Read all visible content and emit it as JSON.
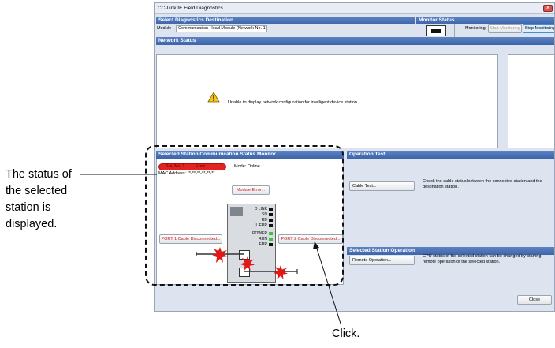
{
  "window": {
    "title": "CC-Link IE Field Diagnostics",
    "close_glyph": "✕"
  },
  "destination": {
    "header": "Select Diagnostics Destination",
    "module_label": "Module",
    "module_value": "Communication Head Module (Network No. 1)"
  },
  "monitor": {
    "header": "Monitor Status",
    "status_text": "Monitoring",
    "start_label": "Start Monitoring",
    "stop_label": "Stop Monitoring"
  },
  "network": {
    "header": "Network Status",
    "warning_icon": "warning-icon",
    "message": "Unable to display network configuration for intelligent device station."
  },
  "station_monitor": {
    "header": "Selected Station Communication Status Monitor",
    "station_no": "Sta. No. 1",
    "station_state": "Error",
    "mode": "Mode:  Online",
    "mac": "MAC Address: **-**-**-**-**-**",
    "module_error_label": "Module Error...",
    "port1_label": "PORT 1 Cable Disconnected...",
    "port2_label": "PORT 2 Cable Disconnected...",
    "leds_top": [
      "D LINK",
      "SD",
      "RD",
      "L ERR"
    ],
    "leds_bottom": [
      "POWER",
      "RUN",
      "ERR"
    ]
  },
  "operation_test": {
    "header": "Operation Test",
    "cable_test_label": "Cable Test...",
    "cable_test_desc": "Check the cable status between the connected station and the destination station."
  },
  "station_operation": {
    "header": "Selected Station Operation",
    "remote_label": "Remote Operation...",
    "remote_desc": "CPU status of the selected station can be changed by starting remote operation of the selected station."
  },
  "footer": {
    "close_label": "Close"
  },
  "annotations": {
    "status_lines": [
      "The status of",
      "the selected",
      "station is",
      "displayed."
    ],
    "click_label": "Click."
  },
  "colors": {
    "accent": "#3d64a8",
    "error": "#e32222",
    "starburst": "#e01818"
  }
}
